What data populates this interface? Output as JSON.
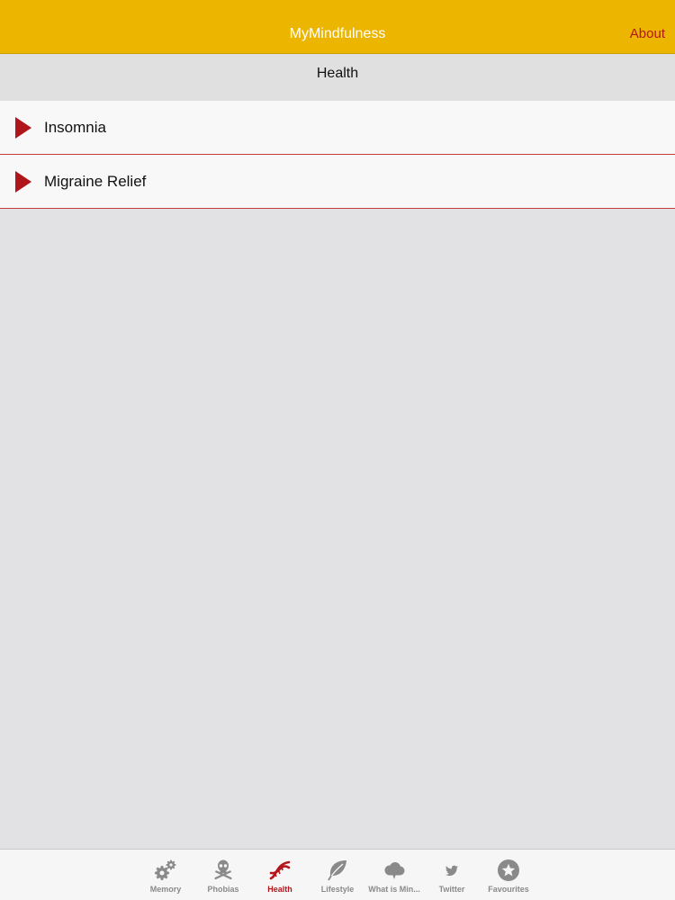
{
  "app": {
    "title": "MyMindfulness",
    "about_label": "About"
  },
  "section": {
    "title": "Health"
  },
  "items": [
    {
      "label": "Insomnia"
    },
    {
      "label": "Migraine Relief"
    }
  ],
  "tabs": [
    {
      "label": "Memory",
      "icon": "gears-icon",
      "active": false
    },
    {
      "label": "Phobias",
      "icon": "skull-icon",
      "active": false
    },
    {
      "label": "Health",
      "icon": "dna-icon",
      "active": true
    },
    {
      "label": "Lifestyle",
      "icon": "leaf-icon",
      "active": false
    },
    {
      "label": "What is Min...",
      "icon": "cloud-icon",
      "active": false
    },
    {
      "label": "Twitter",
      "icon": "twitter-icon",
      "active": false
    },
    {
      "label": "Favourites",
      "icon": "star-icon",
      "active": false
    }
  ],
  "colors": {
    "header": "#ebb500",
    "accent": "#b4161b",
    "inactive": "#8a8a8a"
  }
}
